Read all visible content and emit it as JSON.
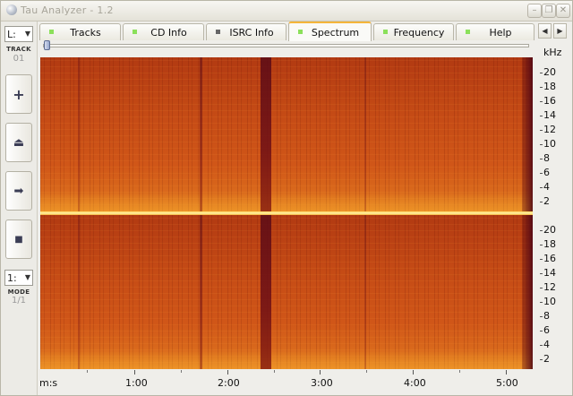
{
  "window": {
    "title": "Tau Analyzer - 1.2",
    "controls": [
      "minimize",
      "maximize",
      "close"
    ]
  },
  "left_panel": {
    "channel_select": {
      "value": "L:"
    },
    "track_label": "TRACK",
    "track_value": "01",
    "buttons": [
      {
        "icon": "plus-icon",
        "glyph": "+"
      },
      {
        "icon": "eject-icon",
        "glyph": "⏏"
      },
      {
        "icon": "play-icon",
        "glyph": "➡"
      },
      {
        "icon": "stop-icon",
        "glyph": "■"
      }
    ],
    "mode_select": {
      "value": "1:"
    },
    "mode_label": "MODE",
    "mode_value": "1/1"
  },
  "tabs": [
    {
      "label": "Tracks",
      "active": false,
      "indicator": "#8be05a"
    },
    {
      "label": "CD Info",
      "active": false,
      "indicator": "#8be05a"
    },
    {
      "label": "ISRC Info",
      "active": false,
      "indicator": "#666666"
    },
    {
      "label": "Spectrum",
      "active": true,
      "indicator": "#8be05a"
    },
    {
      "label": "Frequency",
      "active": false,
      "indicator": "#8be05a"
    },
    {
      "label": "Help",
      "active": false,
      "indicator": "#8be05a"
    }
  ],
  "tab_scroll": {
    "left": "◀",
    "right": "▶"
  },
  "slider": {
    "position": 0.0
  },
  "spectrum": {
    "frequency_unit": "kHz",
    "frequency_ticks_top": [
      "20",
      "18",
      "16",
      "14",
      "12",
      "10",
      "8",
      "6",
      "4",
      "2"
    ],
    "frequency_ticks_bottom": [
      "20",
      "18",
      "16",
      "14",
      "12",
      "10",
      "8",
      "6",
      "4",
      "2"
    ],
    "time_unit": "m:s",
    "time_ticks": [
      "1:00",
      "2:00",
      "3:00",
      "4:00",
      "5:00"
    ],
    "colors": {
      "low": "#7a0f18",
      "mid": "#c44a15",
      "high": "#f1a33a"
    }
  }
}
